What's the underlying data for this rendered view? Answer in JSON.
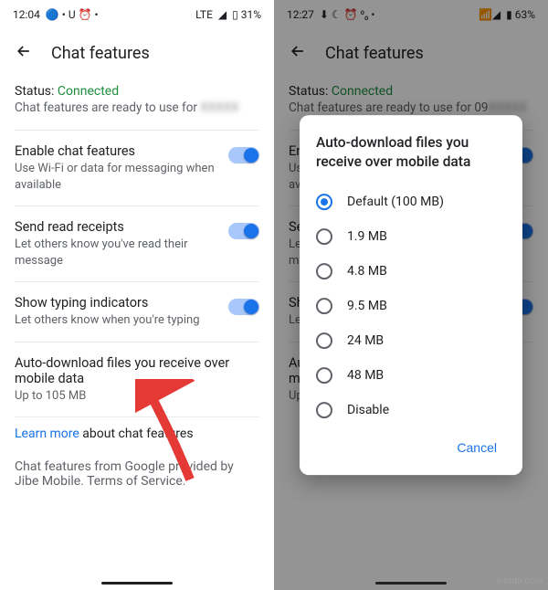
{
  "left": {
    "status_bar": {
      "time": "12:04",
      "icons_left": "🔵 • U ⏰ •",
      "net": "LTE",
      "signal": "◢",
      "battery": "▯ 31%"
    },
    "app_bar_title": "Chat features",
    "status_label": "Status: ",
    "status_value": "Connected",
    "status_desc_prefix": "Chat features are ready to use for ",
    "status_desc_blur": "XXXXX",
    "s1_title": "Enable chat features",
    "s1_sub": "Use Wi-Fi or data for messaging when available",
    "s2_title": "Send read receipts",
    "s2_sub": "Let others know you've read their message",
    "s3_title": "Show typing indicators",
    "s3_sub": "Let others know when you're typing",
    "s4_title": "Auto-download files you receive over mobile data",
    "s4_sub": "Up to 105 MB",
    "learn_more": "Learn more",
    "learn_more_rest": " about chat features",
    "footer": "Chat features from Google provided by Jibe Mobile. Terms of Service."
  },
  "right": {
    "status_bar": {
      "time": "12:27",
      "icons_left": "⬇ ☾ ⏰ ⁰₀ •",
      "signal": "📶◢",
      "battery": "▮ 63%"
    },
    "app_bar_title": "Chat features",
    "status_label": "Status: ",
    "status_value": "Connected",
    "status_desc_prefix": "Chat features are ready to use for 09",
    "status_desc_blur": "XXXXX",
    "dialog_title": "Auto-download files you receive over mobile data",
    "options": [
      "Default (100 MB)",
      "1.9 MB",
      "4.8 MB",
      "9.5 MB",
      "24 MB",
      "48 MB",
      "Disable"
    ],
    "cancel": "Cancel"
  },
  "watermark": "wsxdn.com"
}
